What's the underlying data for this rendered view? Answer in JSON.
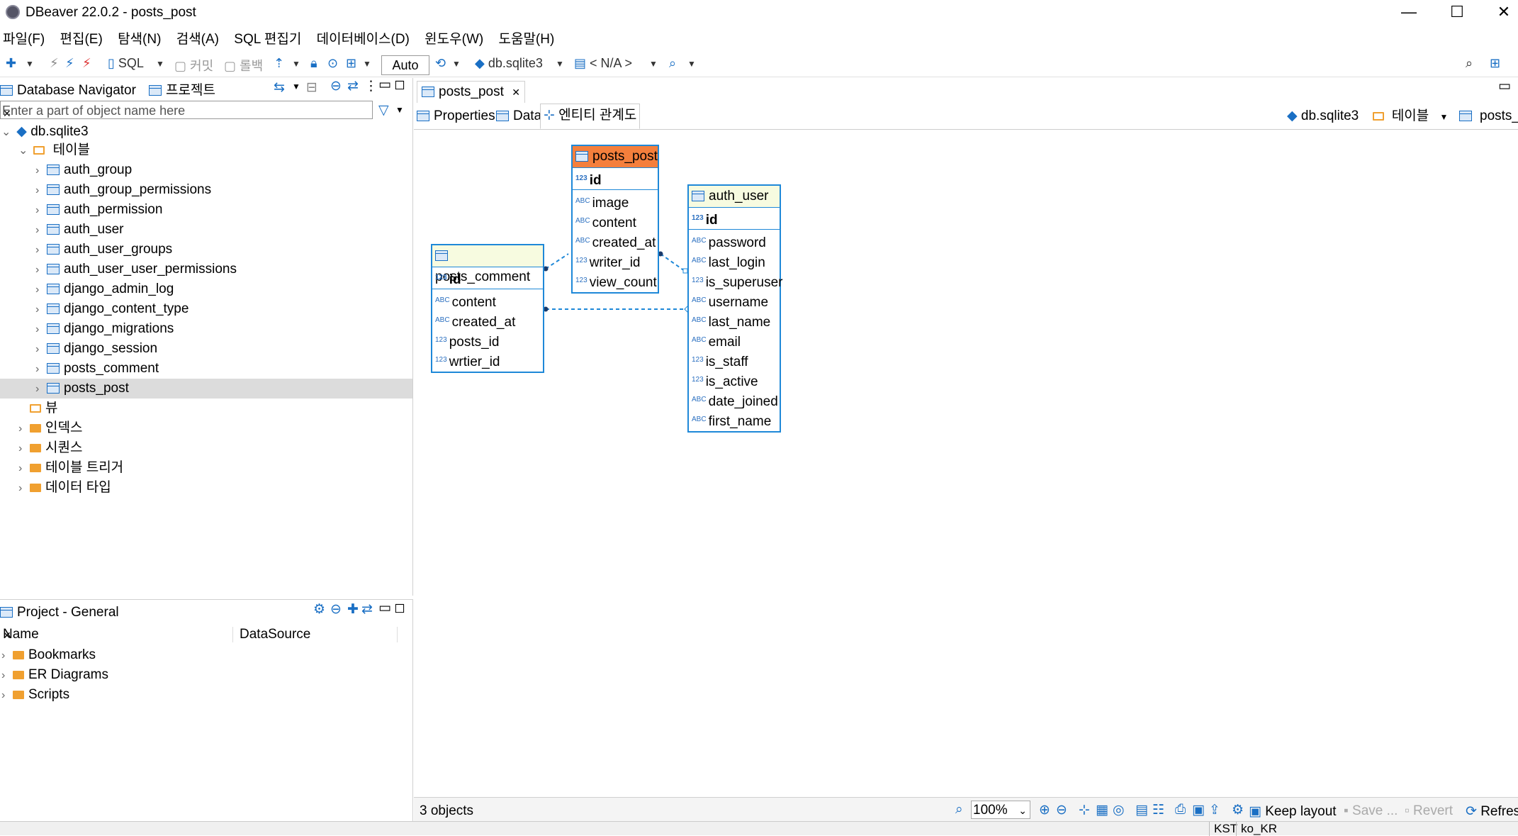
{
  "window": {
    "title": "DBeaver 22.0.2 - posts_post",
    "minimize": "—",
    "maximize": "☐",
    "close": "✕"
  },
  "menu": [
    "파일(F)",
    "편집(E)",
    "탐색(N)",
    "검색(A)",
    "SQL 편집기",
    "데이터베이스(D)",
    "윈도우(W)",
    "도움말(H)"
  ],
  "toolbar": {
    "sql": "SQL",
    "commit": "커밋",
    "rollback": "롤백",
    "mode": "Auto",
    "datasource": "db.sqlite3",
    "schema": "< N/A >"
  },
  "navigator": {
    "tab1": "Database Navigator",
    "tab2": "프로젝트",
    "filter_placeholder": "Enter a part of object name here",
    "root": "db.sqlite3",
    "tables_folder": "테이블",
    "tables": [
      "auth_group",
      "auth_group_permissions",
      "auth_permission",
      "auth_user",
      "auth_user_groups",
      "auth_user_user_permissions",
      "django_admin_log",
      "django_content_type",
      "django_migrations",
      "django_session",
      "posts_comment",
      "posts_post"
    ],
    "selected": "posts_post",
    "view_folder": "뷰",
    "other_folders": [
      "인덱스",
      "시퀀스",
      "테이블 트리거",
      "데이터 타입"
    ]
  },
  "project": {
    "tab": "Project - General",
    "col_name": "Name",
    "col_datasource": "DataSource",
    "items": [
      "Bookmarks",
      "ER Diagrams",
      "Scripts"
    ]
  },
  "editor": {
    "tab": "posts_post",
    "subtabs": [
      "Properties",
      "Data",
      "엔티티 관계도"
    ],
    "active_subtab": "엔티티 관계도",
    "breadcrumb": [
      "db.sqlite3",
      "테이블",
      "posts_post"
    ]
  },
  "diagram": {
    "entities": [
      {
        "name": "posts_post",
        "key": "id",
        "key_type": "123",
        "highlight": true,
        "columns": [
          {
            "name": "image",
            "type": "ABC"
          },
          {
            "name": "content",
            "type": "ABC"
          },
          {
            "name": "created_at",
            "type": "ABC"
          },
          {
            "name": "writer_id",
            "type": "123"
          },
          {
            "name": "view_count",
            "type": "123"
          }
        ]
      },
      {
        "name": "posts_comment",
        "key": "id",
        "key_type": "123",
        "highlight": false,
        "columns": [
          {
            "name": "content",
            "type": "ABC"
          },
          {
            "name": "created_at",
            "type": "ABC"
          },
          {
            "name": "posts_id",
            "type": "123"
          },
          {
            "name": "wrtier_id",
            "type": "123"
          }
        ]
      },
      {
        "name": "auth_user",
        "key": "id",
        "key_type": "123",
        "highlight": false,
        "columns": [
          {
            "name": "password",
            "type": "ABC"
          },
          {
            "name": "last_login",
            "type": "ABC"
          },
          {
            "name": "is_superuser",
            "type": "123"
          },
          {
            "name": "username",
            "type": "ABC"
          },
          {
            "name": "last_name",
            "type": "ABC"
          },
          {
            "name": "email",
            "type": "ABC"
          },
          {
            "name": "is_staff",
            "type": "123"
          },
          {
            "name": "is_active",
            "type": "123"
          },
          {
            "name": "date_joined",
            "type": "ABC"
          },
          {
            "name": "first_name",
            "type": "ABC"
          }
        ]
      }
    ]
  },
  "statusbar": {
    "objects": "3 objects",
    "zoom": "100%",
    "keep_layout": "Keep layout",
    "save": "Save ...",
    "revert": "Revert",
    "refresh": "Refresh"
  },
  "bottombar": {
    "tz": "KST",
    "locale": "ko_KR"
  },
  "colors": {
    "accent": "#1e88d8",
    "highlight": "#f47f3c",
    "folder": "#f0a030"
  }
}
